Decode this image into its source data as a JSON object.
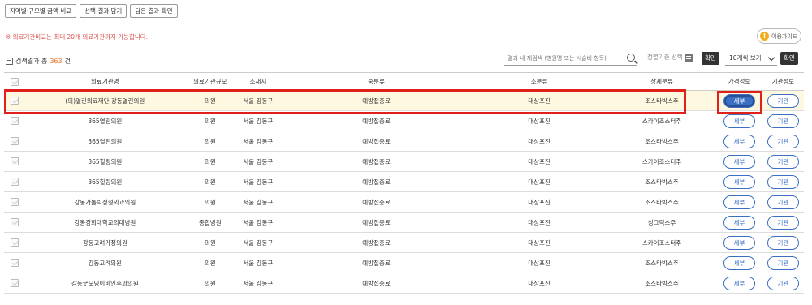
{
  "toolbar": {
    "compare_label": "지역별·규모별 금액 비교",
    "add_selected_label": "선택 결과 담기",
    "view_saved_label": "담은 결과 확인"
  },
  "notice": "※ 의료기관비교는 최대 20개 의료기관까지 가능합니다.",
  "guide_label": "이용가이드",
  "guide_icon": "exclamation-icon",
  "result": {
    "prefix": "검색결과 총",
    "count": "363",
    "suffix": "건"
  },
  "search": {
    "placeholder": "결과 내 재검색 (병원명 또는 시술비 항목)"
  },
  "sort_label": "정렬기준 선택",
  "confirm_label": "확인",
  "page_size_label": "10개씩 보기",
  "columns": [
    "",
    "의료기관명",
    "의료기관규모",
    "소재지",
    "중분류",
    "소분류",
    "상세분류",
    "가격정보",
    "기관정보"
  ],
  "detail_label": "세부",
  "org_label": "기관",
  "colors": {
    "accent": "#3a6fc4",
    "highlight_row": "#fff8e1",
    "notice": "#d9534f",
    "count": "#e37222",
    "annotation_box": "#e0201b"
  },
  "rows": [
    {
      "name": "(의)열린의료재단 강동열린의원",
      "size": "의원",
      "location": "서울 강동구",
      "mid": "예방접종료",
      "small": "대상포진",
      "detail": "조스타박스주"
    },
    {
      "name": "365열린의원",
      "size": "의원",
      "location": "서울 강동구",
      "mid": "예방접종료",
      "small": "대상포진",
      "detail": "스카이조스터주"
    },
    {
      "name": "365열린의원",
      "size": "의원",
      "location": "서울 강동구",
      "mid": "예방접종료",
      "small": "대상포진",
      "detail": "조스타박스주"
    },
    {
      "name": "365힐링의원",
      "size": "의원",
      "location": "서울 강동구",
      "mid": "예방접종료",
      "small": "대상포진",
      "detail": "스카이조스터주"
    },
    {
      "name": "365힐링의원",
      "size": "의원",
      "location": "서울 강동구",
      "mid": "예방접종료",
      "small": "대상포진",
      "detail": "조스타박스주"
    },
    {
      "name": "강동가톨릭정형외과의원",
      "size": "의원",
      "location": "서울 강동구",
      "mid": "예방접종료",
      "small": "대상포진",
      "detail": "조스타박스주"
    },
    {
      "name": "강동경희대학교의대병원",
      "size": "종합병원",
      "location": "서울 강동구",
      "mid": "예방접종료",
      "small": "대상포진",
      "detail": "싱그릭스주"
    },
    {
      "name": "강동고려가정의원",
      "size": "의원",
      "location": "서울 강동구",
      "mid": "예방접종료",
      "small": "대상포진",
      "detail": "스카이조스터주"
    },
    {
      "name": "강동고려의원",
      "size": "의원",
      "location": "서울 강동구",
      "mid": "예방접종료",
      "small": "대상포진",
      "detail": "조스타박스주"
    },
    {
      "name": "강동굿모닝이비인후과의원",
      "size": "의원",
      "location": "서울 강동구",
      "mid": "예방접종료",
      "small": "대상포진",
      "detail": "조스타박스주"
    }
  ]
}
